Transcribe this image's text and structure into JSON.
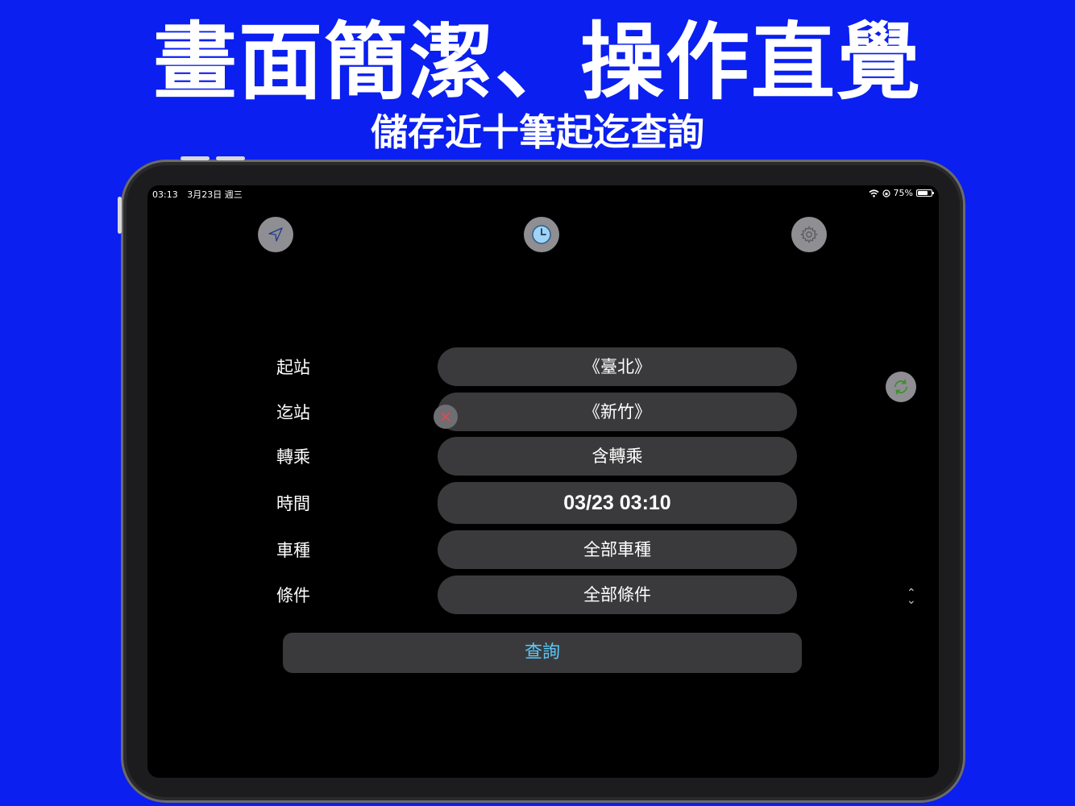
{
  "banner": {
    "headline": "畫面簡潔、操作直覺",
    "subline": "儲存近十筆起迄查詢"
  },
  "statusbar": {
    "time": "03:13",
    "date": "3月23日 週三",
    "battery": "75%",
    "battery_level": 0.75
  },
  "toolbar": {
    "location_icon": "location-arrow-icon",
    "history_icon": "clock-icon",
    "settings_icon": "gear-icon"
  },
  "form": {
    "rows": [
      {
        "label": "起站",
        "value": "《臺北》"
      },
      {
        "label": "迄站",
        "value": "《新竹》"
      },
      {
        "label": "轉乘",
        "value": "含轉乘"
      },
      {
        "label": "時間",
        "value": "03/23 03:10"
      },
      {
        "label": "車種",
        "value": "全部車種"
      },
      {
        "label": "條件",
        "value": "全部條件"
      }
    ],
    "search_label": "查詢",
    "swap_icon": "swap-arrows-icon",
    "clear_icon": "close-icon"
  },
  "colors": {
    "background": "#0a1ff0",
    "pill": "#3a3a3c",
    "accent": "#5ac8fa",
    "clock_accent": "#9fd4f5",
    "swap_accent": "#5fb23c",
    "clear_accent": "#e5484d"
  }
}
